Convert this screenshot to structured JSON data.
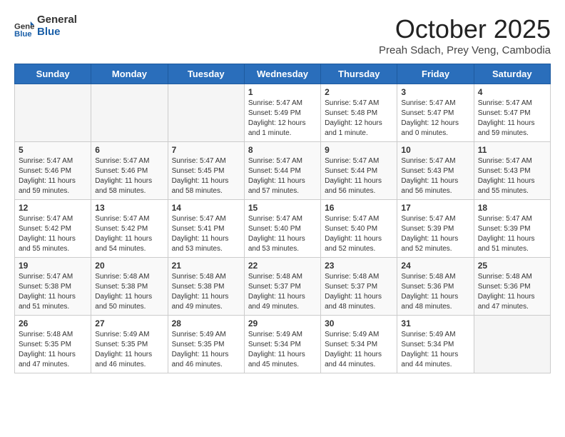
{
  "header": {
    "logo_general": "General",
    "logo_blue": "Blue",
    "title": "October 2025",
    "subtitle": "Preah Sdach, Prey Veng, Cambodia"
  },
  "days_of_week": [
    "Sunday",
    "Monday",
    "Tuesday",
    "Wednesday",
    "Thursday",
    "Friday",
    "Saturday"
  ],
  "weeks": [
    [
      {
        "day": "",
        "info": ""
      },
      {
        "day": "",
        "info": ""
      },
      {
        "day": "",
        "info": ""
      },
      {
        "day": "1",
        "info": "Sunrise: 5:47 AM\nSunset: 5:49 PM\nDaylight: 12 hours\nand 1 minute."
      },
      {
        "day": "2",
        "info": "Sunrise: 5:47 AM\nSunset: 5:48 PM\nDaylight: 12 hours\nand 1 minute."
      },
      {
        "day": "3",
        "info": "Sunrise: 5:47 AM\nSunset: 5:47 PM\nDaylight: 12 hours\nand 0 minutes."
      },
      {
        "day": "4",
        "info": "Sunrise: 5:47 AM\nSunset: 5:47 PM\nDaylight: 11 hours\nand 59 minutes."
      }
    ],
    [
      {
        "day": "5",
        "info": "Sunrise: 5:47 AM\nSunset: 5:46 PM\nDaylight: 11 hours\nand 59 minutes."
      },
      {
        "day": "6",
        "info": "Sunrise: 5:47 AM\nSunset: 5:46 PM\nDaylight: 11 hours\nand 58 minutes."
      },
      {
        "day": "7",
        "info": "Sunrise: 5:47 AM\nSunset: 5:45 PM\nDaylight: 11 hours\nand 58 minutes."
      },
      {
        "day": "8",
        "info": "Sunrise: 5:47 AM\nSunset: 5:44 PM\nDaylight: 11 hours\nand 57 minutes."
      },
      {
        "day": "9",
        "info": "Sunrise: 5:47 AM\nSunset: 5:44 PM\nDaylight: 11 hours\nand 56 minutes."
      },
      {
        "day": "10",
        "info": "Sunrise: 5:47 AM\nSunset: 5:43 PM\nDaylight: 11 hours\nand 56 minutes."
      },
      {
        "day": "11",
        "info": "Sunrise: 5:47 AM\nSunset: 5:43 PM\nDaylight: 11 hours\nand 55 minutes."
      }
    ],
    [
      {
        "day": "12",
        "info": "Sunrise: 5:47 AM\nSunset: 5:42 PM\nDaylight: 11 hours\nand 55 minutes."
      },
      {
        "day": "13",
        "info": "Sunrise: 5:47 AM\nSunset: 5:42 PM\nDaylight: 11 hours\nand 54 minutes."
      },
      {
        "day": "14",
        "info": "Sunrise: 5:47 AM\nSunset: 5:41 PM\nDaylight: 11 hours\nand 53 minutes."
      },
      {
        "day": "15",
        "info": "Sunrise: 5:47 AM\nSunset: 5:40 PM\nDaylight: 11 hours\nand 53 minutes."
      },
      {
        "day": "16",
        "info": "Sunrise: 5:47 AM\nSunset: 5:40 PM\nDaylight: 11 hours\nand 52 minutes."
      },
      {
        "day": "17",
        "info": "Sunrise: 5:47 AM\nSunset: 5:39 PM\nDaylight: 11 hours\nand 52 minutes."
      },
      {
        "day": "18",
        "info": "Sunrise: 5:47 AM\nSunset: 5:39 PM\nDaylight: 11 hours\nand 51 minutes."
      }
    ],
    [
      {
        "day": "19",
        "info": "Sunrise: 5:47 AM\nSunset: 5:38 PM\nDaylight: 11 hours\nand 51 minutes."
      },
      {
        "day": "20",
        "info": "Sunrise: 5:48 AM\nSunset: 5:38 PM\nDaylight: 11 hours\nand 50 minutes."
      },
      {
        "day": "21",
        "info": "Sunrise: 5:48 AM\nSunset: 5:38 PM\nDaylight: 11 hours\nand 49 minutes."
      },
      {
        "day": "22",
        "info": "Sunrise: 5:48 AM\nSunset: 5:37 PM\nDaylight: 11 hours\nand 49 minutes."
      },
      {
        "day": "23",
        "info": "Sunrise: 5:48 AM\nSunset: 5:37 PM\nDaylight: 11 hours\nand 48 minutes."
      },
      {
        "day": "24",
        "info": "Sunrise: 5:48 AM\nSunset: 5:36 PM\nDaylight: 11 hours\nand 48 minutes."
      },
      {
        "day": "25",
        "info": "Sunrise: 5:48 AM\nSunset: 5:36 PM\nDaylight: 11 hours\nand 47 minutes."
      }
    ],
    [
      {
        "day": "26",
        "info": "Sunrise: 5:48 AM\nSunset: 5:35 PM\nDaylight: 11 hours\nand 47 minutes."
      },
      {
        "day": "27",
        "info": "Sunrise: 5:49 AM\nSunset: 5:35 PM\nDaylight: 11 hours\nand 46 minutes."
      },
      {
        "day": "28",
        "info": "Sunrise: 5:49 AM\nSunset: 5:35 PM\nDaylight: 11 hours\nand 46 minutes."
      },
      {
        "day": "29",
        "info": "Sunrise: 5:49 AM\nSunset: 5:34 PM\nDaylight: 11 hours\nand 45 minutes."
      },
      {
        "day": "30",
        "info": "Sunrise: 5:49 AM\nSunset: 5:34 PM\nDaylight: 11 hours\nand 44 minutes."
      },
      {
        "day": "31",
        "info": "Sunrise: 5:49 AM\nSunset: 5:34 PM\nDaylight: 11 hours\nand 44 minutes."
      },
      {
        "day": "",
        "info": ""
      }
    ]
  ]
}
